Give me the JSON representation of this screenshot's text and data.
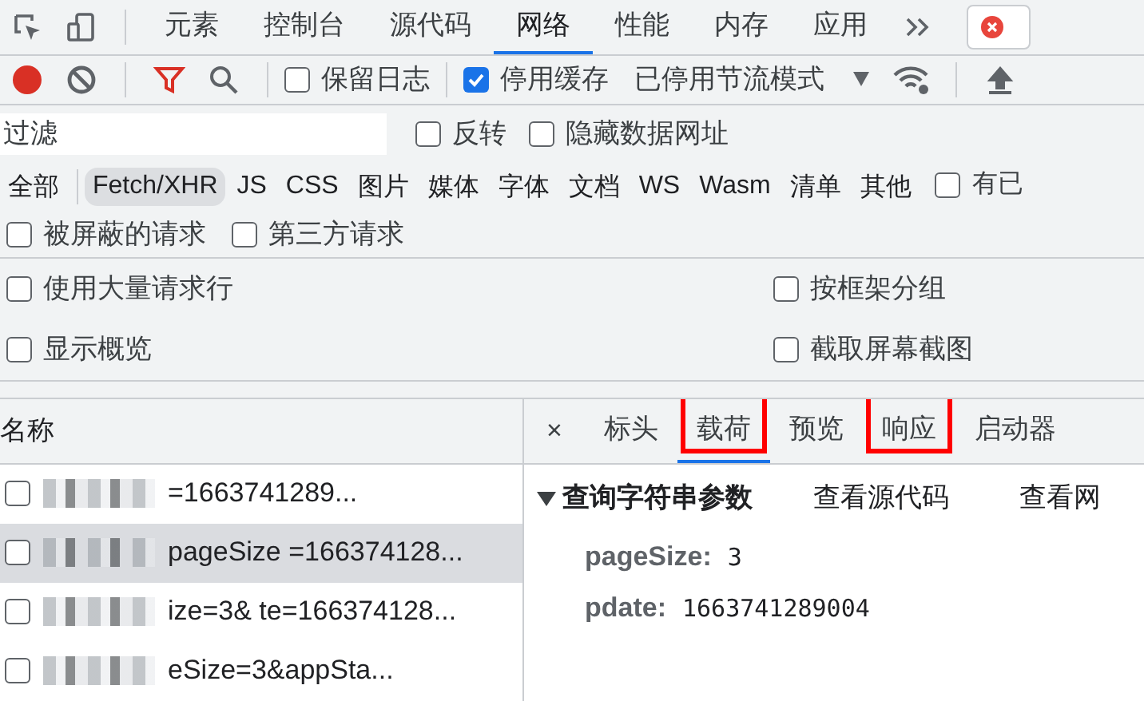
{
  "main_tabs": [
    {
      "label": "元素",
      "selected": false
    },
    {
      "label": "控制台",
      "selected": false
    },
    {
      "label": "源代码",
      "selected": false
    },
    {
      "label": "网络",
      "selected": true
    },
    {
      "label": "性能",
      "selected": false
    },
    {
      "label": "内存",
      "selected": false
    },
    {
      "label": "应用",
      "selected": false
    }
  ],
  "toolbar": {
    "recording": true,
    "filter_active": true,
    "preserve_log": {
      "label": "保留日志",
      "checked": false
    },
    "disable_cache": {
      "label": "停用缓存",
      "checked": true
    },
    "throttling": "已停用节流模式"
  },
  "filter": {
    "placeholder": "过滤",
    "options": [
      {
        "label": "反转",
        "checked": false
      },
      {
        "label": "隐藏数据网址",
        "checked": false
      }
    ]
  },
  "type_filters": [
    {
      "label": "全部",
      "selected": false
    },
    {
      "label": "Fetch/XHR",
      "selected": true
    },
    {
      "label": "JS",
      "selected": false
    },
    {
      "label": "CSS",
      "selected": false
    },
    {
      "label": "图片",
      "selected": false
    },
    {
      "label": "媒体",
      "selected": false
    },
    {
      "label": "字体",
      "selected": false
    },
    {
      "label": "文档",
      "selected": false
    },
    {
      "label": "WS",
      "selected": false
    },
    {
      "label": "Wasm",
      "selected": false
    },
    {
      "label": "清单",
      "selected": false
    },
    {
      "label": "其他",
      "selected": false
    }
  ],
  "type_extra": {
    "label": "有已",
    "checked": false
  },
  "request_options": [
    {
      "label": "被屏蔽的请求",
      "checked": false
    },
    {
      "label": "第三方请求",
      "checked": false
    }
  ],
  "settings": [
    {
      "label": "使用大量请求行",
      "checked": false
    },
    {
      "label": "按框架分组",
      "checked": false
    },
    {
      "label": "显示概览",
      "checked": false
    },
    {
      "label": "截取屏幕截图",
      "checked": false
    }
  ],
  "requests": {
    "column": "名称",
    "rows": [
      {
        "name": "=1663741289...",
        "selected": false
      },
      {
        "name": "pageSize =166374128...",
        "selected": true
      },
      {
        "name": "ize=3& te=166374128...",
        "selected": false
      },
      {
        "name": "eSize=3&appSta...",
        "selected": false
      }
    ]
  },
  "detail": {
    "close": "×",
    "tabs": [
      {
        "label": "标头",
        "selected": false,
        "highlighted": false
      },
      {
        "label": "载荷",
        "selected": true,
        "highlighted": true
      },
      {
        "label": "预览",
        "selected": false,
        "highlighted": false
      },
      {
        "label": "响应",
        "selected": false,
        "highlighted": true
      },
      {
        "label": "启动器",
        "selected": false,
        "highlighted": false
      }
    ],
    "section": {
      "title": "查询字符串参数",
      "expanded": true,
      "links": [
        "查看源代码",
        "查看网"
      ]
    },
    "params": [
      {
        "key": "pageSize:",
        "value": "3"
      },
      {
        "key": "pdate:",
        "value": "1663741289004"
      }
    ]
  }
}
